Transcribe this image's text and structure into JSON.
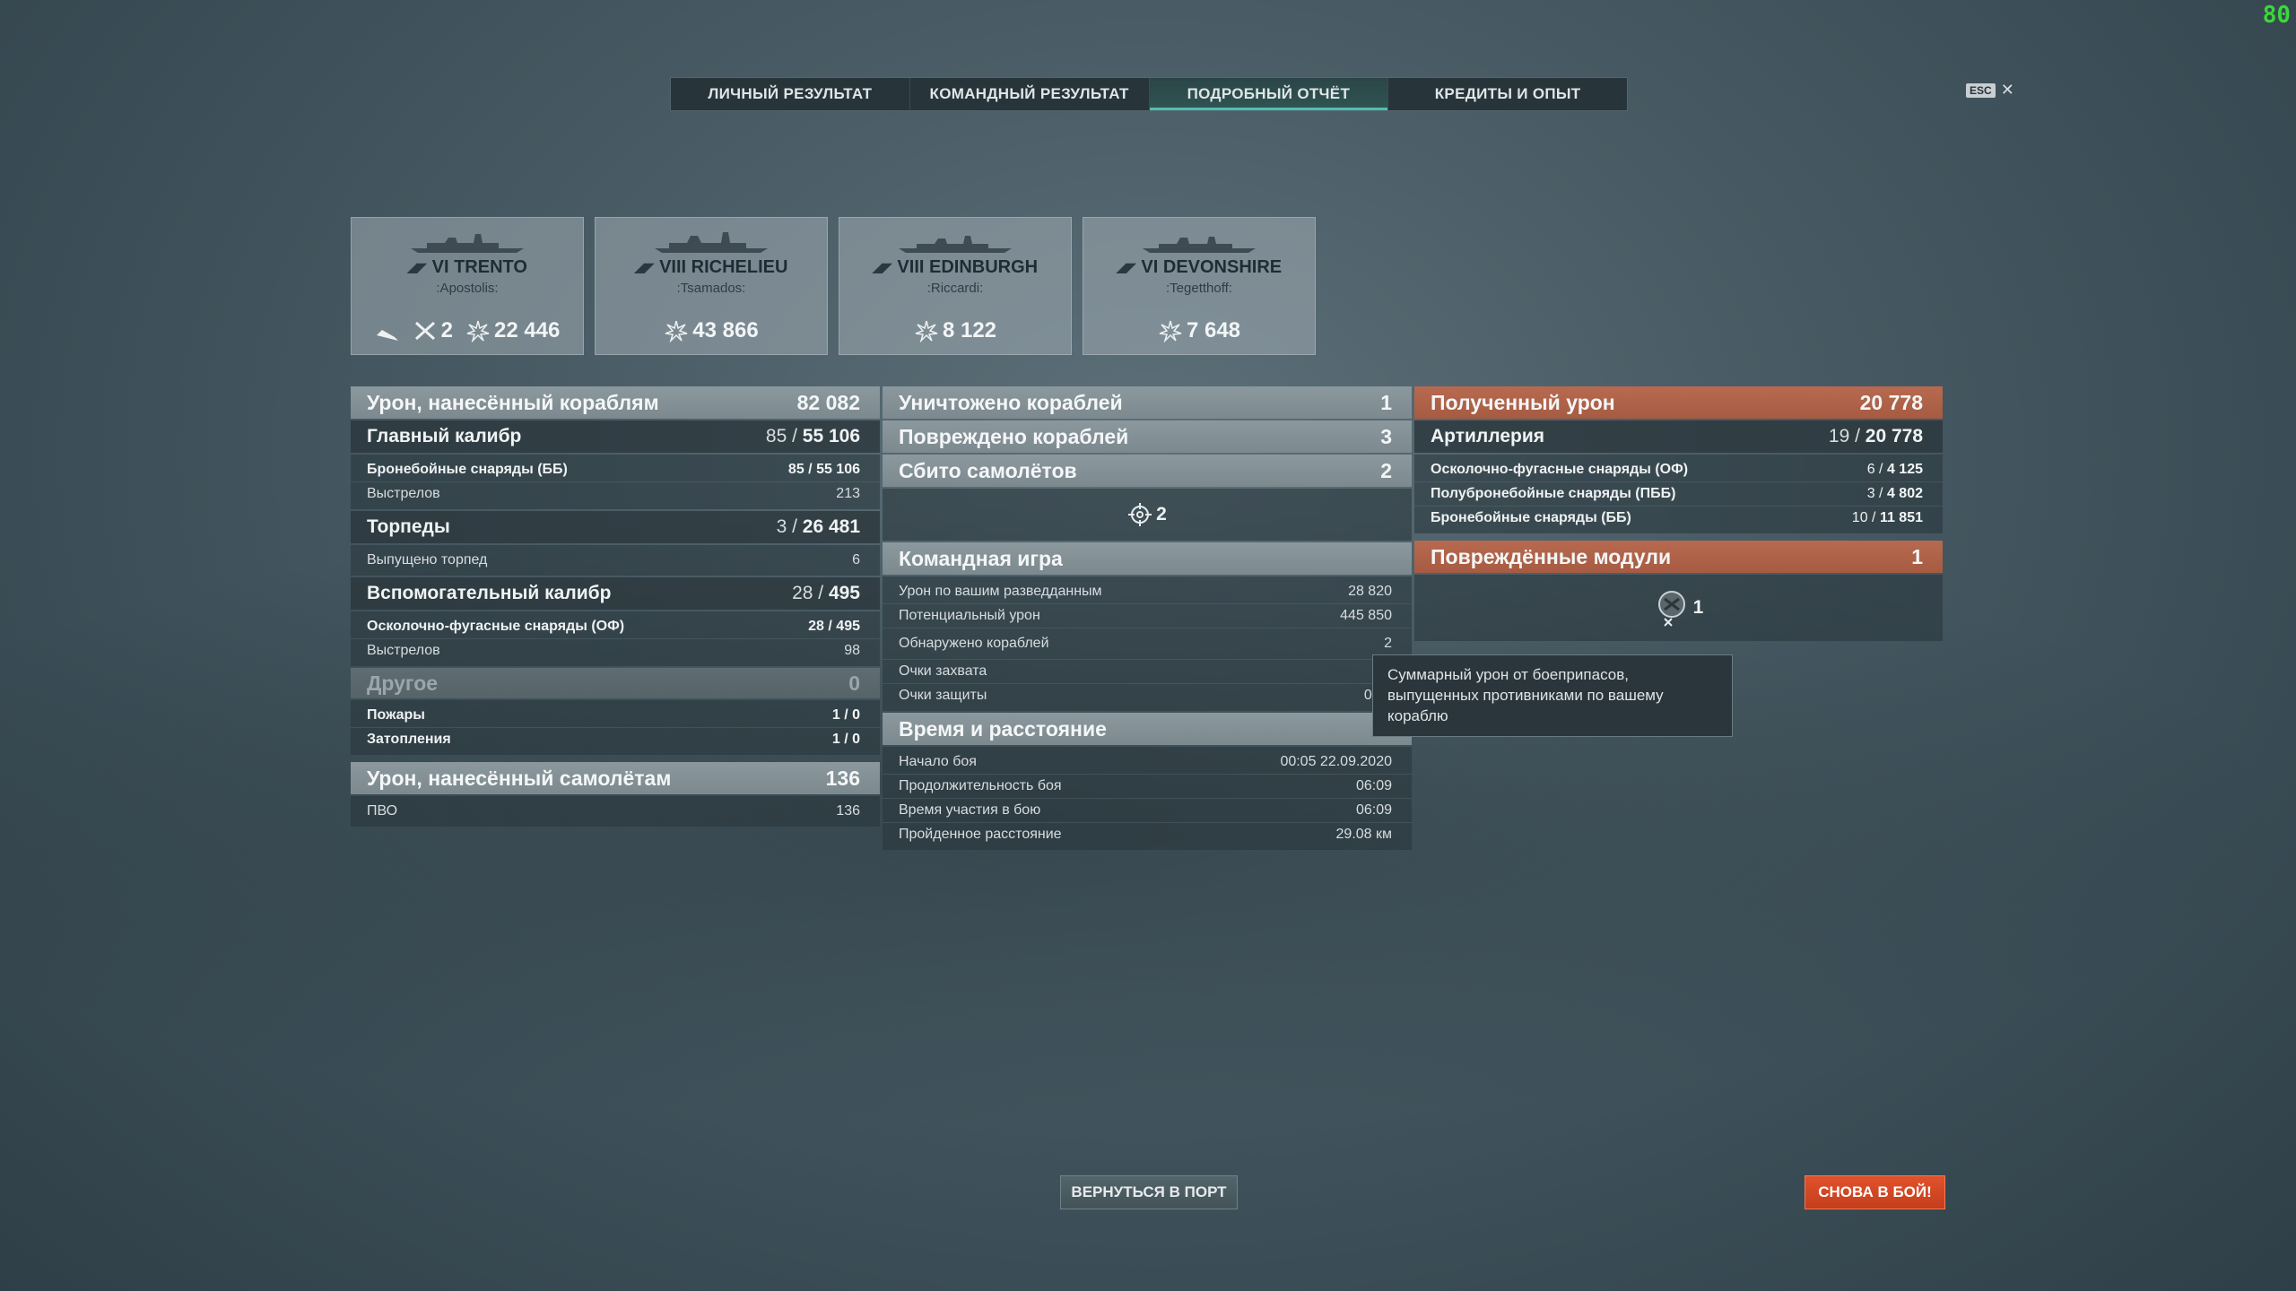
{
  "fps": "80",
  "tabs": [
    "ЛИЧНЫЙ РЕЗУЛЬТАТ",
    "КОМАНДНЫЙ РЕЗУЛЬТАТ",
    "ПОДРОБНЫЙ ОТЧЁТ",
    "КРЕДИТЫ И ОПЫТ"
  ],
  "active_tab": "ПОДРОБНЫЙ ОТЧЁТ",
  "esc_label": "ESC",
  "ships": [
    {
      "name": "VI TRENTO",
      "player": ":Apostolis:",
      "planes": "2",
      "damage": "22 446"
    },
    {
      "name": "VIII RICHELIEU",
      "player": ":Tsamados:",
      "damage": "43 866"
    },
    {
      "name": "VIII EDINBURGH",
      "player": ":Riccardi:",
      "damage": "8 122"
    },
    {
      "name": "VI DEVONSHIRE",
      "player": ":Tegetthoff:",
      "damage": "7 648"
    }
  ],
  "left": {
    "damage_ships": {
      "label": "Урон, нанесённый кораблям",
      "value": "82 082"
    },
    "main_caliber": {
      "label": "Главный калибр",
      "a": "85 /",
      "b": "55 106"
    },
    "main_rows": [
      {
        "label": "Бронебойные снаряды (ББ)",
        "a": "85 /",
        "b": "55 106",
        "bold": true
      },
      {
        "label": "Выстрелов",
        "a": "",
        "b": "213",
        "bold": false
      }
    ],
    "torpedoes": {
      "label": "Торпеды",
      "a": "3 /",
      "b": "26 481"
    },
    "torp_rows": [
      {
        "label": "Выпущено торпед",
        "a": "",
        "b": "6",
        "bold": false
      }
    ],
    "secondary": {
      "label": "Вспомогательный калибр",
      "a": "28 /",
      "b": "495"
    },
    "sec_rows": [
      {
        "label": "Осколочно-фугасные снаряды (ОФ)",
        "a": "28 /",
        "b": "495",
        "bold": true
      },
      {
        "label": "Выстрелов",
        "a": "",
        "b": "98",
        "bold": false
      }
    ],
    "other": {
      "label": "Другое",
      "value": "0"
    },
    "other_rows": [
      {
        "label": "Пожары",
        "a": "1 /",
        "b": "0",
        "bold": true
      },
      {
        "label": "Затопления",
        "a": "1 /",
        "b": "0",
        "bold": true
      }
    ],
    "damage_planes": {
      "label": "Урон, нанесённый самолётам",
      "value": "136"
    },
    "plane_rows": [
      {
        "label": "ПВО",
        "a": "",
        "b": "136",
        "bold": false
      }
    ]
  },
  "middle": {
    "destroyed": {
      "label": "Уничтожено кораблей",
      "value": "1"
    },
    "damaged": {
      "label": "Повреждено кораблей",
      "value": "3"
    },
    "planes_shot": {
      "label": "Сбито самолётов",
      "value": "2"
    },
    "planes_icon_count": "2",
    "team": {
      "label": "Командная игра"
    },
    "team_rows": [
      {
        "label": "Урон по вашим разведданным",
        "value": "28 820"
      },
      {
        "label": "Потенциальный урон",
        "value": "445 850"
      },
      {
        "label": "Обнаружено кораблей",
        "value": "2"
      },
      {
        "label": "Очки захвата",
        "value": "0 /"
      },
      {
        "label": "Очки защиты",
        "value": "0 / 1"
      }
    ],
    "time": {
      "label": "Время и расстояние"
    },
    "time_rows": [
      {
        "label": "Начало боя",
        "value": "00:05  22.09.2020"
      },
      {
        "label": "Продолжительность боя",
        "value": "06:09"
      },
      {
        "label": "Время участия в бою",
        "value": "06:09"
      },
      {
        "label": "Пройденное расстояние",
        "value": "29.08 км"
      }
    ]
  },
  "right": {
    "received": {
      "label": "Полученный урон",
      "value": "20 778"
    },
    "artillery": {
      "label": "Артиллерия",
      "a": "19 /",
      "b": "20 778"
    },
    "art_rows": [
      {
        "label": "Осколочно-фугасные снаряды (ОФ)",
        "a": "6 /",
        "b": "4 125"
      },
      {
        "label": "Полубронебойные снаряды (ПББ)",
        "a": "3 /",
        "b": "4 802"
      },
      {
        "label": "Бронебойные снаряды (ББ)",
        "a": "10 /",
        "b": "11 851"
      }
    ],
    "modules": {
      "label": "Повреждённые модули",
      "value": "1"
    },
    "modules_icon_count": "1"
  },
  "tooltip": "Суммарный урон от боеприпасов, выпущенных противниками по вашему кораблю",
  "buttons": {
    "port": "ВЕРНУТЬСЯ В ПОРТ",
    "battle": "СНОВА В БОЙ!"
  }
}
